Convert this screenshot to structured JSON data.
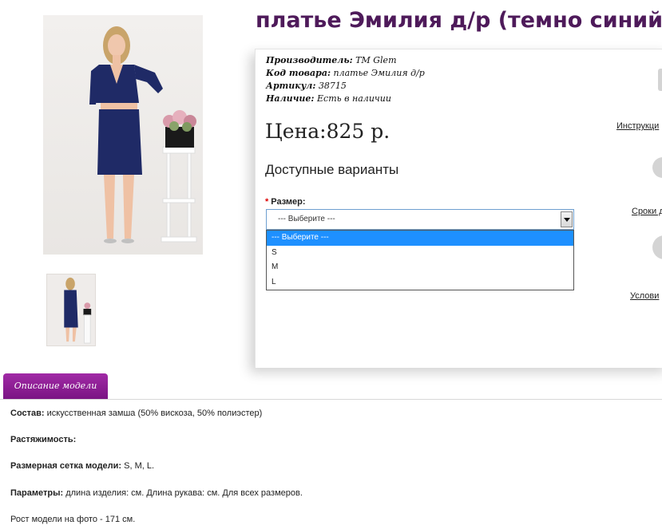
{
  "product": {
    "title": "платье Эмилия д/р (темно синий)"
  },
  "meta": [
    {
      "label": "Производитель:",
      "value": "TM Glem"
    },
    {
      "label": "Код товара:",
      "value": "платье Эмилия д/р"
    },
    {
      "label": "Артикул:",
      "value": "38715"
    },
    {
      "label": "Наличие:",
      "value": "Есть в наличии"
    }
  ],
  "price": "Цена:825 р.",
  "variants": {
    "title": "Доступные варианты",
    "size_label": "Размер:",
    "required_mark": "*",
    "selected": "--- Выберите ---",
    "options": [
      "--- Выберите ---",
      "S",
      "M",
      "L"
    ]
  },
  "side_links": {
    "instructions": "Инструкци",
    "terms": "Сроки д",
    "conditions": "Услови"
  },
  "tabs": {
    "description": "Описание модели"
  },
  "description": [
    {
      "label": "Состав:",
      "value": " искусственная замша (50% вискоза, 50% полиэстер)"
    },
    {
      "label": "Растяжимость:",
      "value": ""
    },
    {
      "label": "Размерная сетка модели:",
      "value": " S, M, L."
    },
    {
      "label": "Параметры:",
      "value": " длина изделия: см. Длина рукава: см. Для всех размеров."
    },
    {
      "label": "",
      "value": "Рост модели на фото - 171 см."
    }
  ],
  "colors": {
    "title": "#4e1a5a",
    "tab": "#8b1a93",
    "dress": "#1f2a66",
    "select_highlight": "#1e90ff"
  }
}
